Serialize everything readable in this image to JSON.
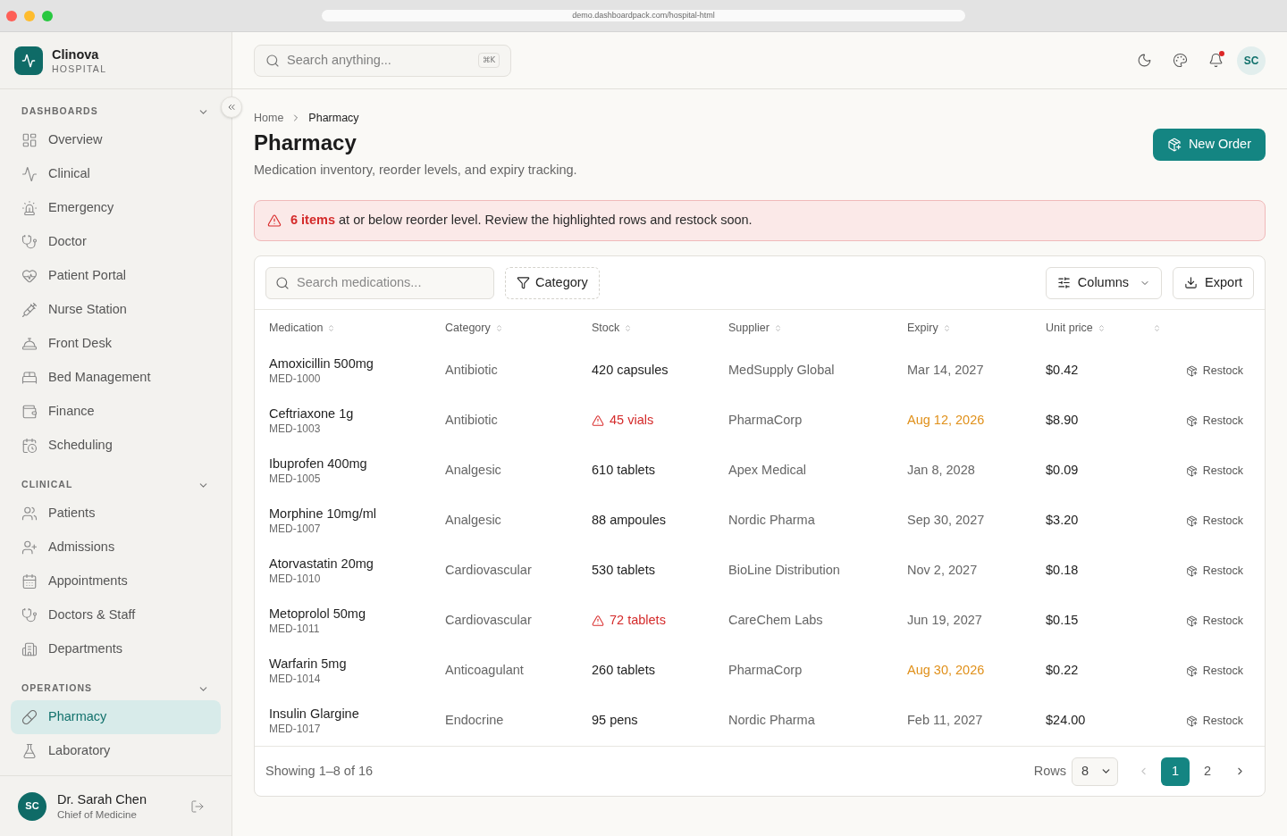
{
  "browser": {
    "url": "demo.dashboardpack.com/hospital-html"
  },
  "sidebar": {
    "brand": {
      "name": "Clinova",
      "subtitle": "HOSPITAL"
    },
    "sections": [
      {
        "title": "DASHBOARDS",
        "expanded": true,
        "items": [
          {
            "label": "Overview",
            "selected": false
          },
          {
            "label": "Clinical",
            "selected": false
          },
          {
            "label": "Emergency",
            "selected": false
          },
          {
            "label": "Doctor",
            "selected": false
          },
          {
            "label": "Patient Portal",
            "selected": false
          },
          {
            "label": "Nurse Station",
            "selected": false
          },
          {
            "label": "Front Desk",
            "selected": false
          },
          {
            "label": "Bed Management",
            "selected": false
          },
          {
            "label": "Finance",
            "selected": false
          },
          {
            "label": "Scheduling",
            "selected": false
          }
        ]
      },
      {
        "title": "CLINICAL",
        "expanded": true,
        "items": [
          {
            "label": "Patients",
            "selected": false
          },
          {
            "label": "Admissions",
            "selected": false
          },
          {
            "label": "Appointments",
            "selected": false
          },
          {
            "label": "Doctors & Staff",
            "selected": false
          },
          {
            "label": "Departments",
            "selected": false
          }
        ]
      },
      {
        "title": "OPERATIONS",
        "expanded": true,
        "items": [
          {
            "label": "Pharmacy",
            "selected": true
          },
          {
            "label": "Laboratory",
            "selected": false
          }
        ]
      }
    ],
    "user": {
      "initials": "SC",
      "name": "Dr. Sarah Chen",
      "role": "Chief of Medicine"
    }
  },
  "header": {
    "search": {
      "placeholder": "Search anything...",
      "shortcut": "⌘K"
    },
    "notifications_unread": true,
    "avatar_initials": "SC"
  },
  "page": {
    "breadcrumb": [
      "Home",
      "Pharmacy"
    ],
    "title": "Pharmacy",
    "subtitle": "Medication inventory, reorder levels, and expiry tracking.",
    "primary_action": "New Order"
  },
  "alert": {
    "text": "**6 items** at or below reorder level. Review the highlighted rows and restock soon."
  },
  "table": {
    "search_placeholder": "Search medications...",
    "filter_label": "Category",
    "columns_button": "Columns",
    "export_button": "Export",
    "columns": [
      "Medication",
      "Category",
      "Stock",
      "Supplier",
      "Expiry",
      "Unit price"
    ],
    "rows": [
      {
        "name": "Amoxicillin 500mg",
        "code": "MED-1000",
        "category": "Antibiotic",
        "stock": "420 capsules",
        "stock_low": false,
        "supplier": "MedSupply Global",
        "expiry": "Mar 14, 2027",
        "expiry_soon": false,
        "unit_price": "$0.42",
        "action": "Restock"
      },
      {
        "name": "Ceftriaxone 1g",
        "code": "MED-1003",
        "category": "Antibiotic",
        "stock": "45 vials",
        "stock_low": true,
        "supplier": "PharmaCorp",
        "expiry": "Aug 12, 2026",
        "expiry_soon": true,
        "unit_price": "$8.90",
        "action": "Restock"
      },
      {
        "name": "Ibuprofen 400mg",
        "code": "MED-1005",
        "category": "Analgesic",
        "stock": "610 tablets",
        "stock_low": false,
        "supplier": "Apex Medical",
        "expiry": "Jan 8, 2028",
        "expiry_soon": false,
        "unit_price": "$0.09",
        "action": "Restock"
      },
      {
        "name": "Morphine 10mg/ml",
        "code": "MED-1007",
        "category": "Analgesic",
        "stock": "88 ampoules",
        "stock_low": false,
        "supplier": "Nordic Pharma",
        "expiry": "Sep 30, 2027",
        "expiry_soon": false,
        "unit_price": "$3.20",
        "action": "Restock"
      },
      {
        "name": "Atorvastatin 20mg",
        "code": "MED-1010",
        "category": "Cardiovascular",
        "stock": "530 tablets",
        "stock_low": false,
        "supplier": "BioLine Distribution",
        "expiry": "Nov 2, 2027",
        "expiry_soon": false,
        "unit_price": "$0.18",
        "action": "Restock"
      },
      {
        "name": "Metoprolol 50mg",
        "code": "MED-1011",
        "category": "Cardiovascular",
        "stock": "72 tablets",
        "stock_low": true,
        "supplier": "CareChem Labs",
        "expiry": "Jun 19, 2027",
        "expiry_soon": false,
        "unit_price": "$0.15",
        "action": "Restock"
      },
      {
        "name": "Warfarin 5mg",
        "code": "MED-1014",
        "category": "Anticoagulant",
        "stock": "260 tablets",
        "stock_low": false,
        "supplier": "PharmaCorp",
        "expiry": "Aug 30, 2026",
        "expiry_soon": true,
        "unit_price": "$0.22",
        "action": "Restock"
      },
      {
        "name": "Insulin Glargine",
        "code": "MED-1017",
        "category": "Endocrine",
        "stock": "95 pens",
        "stock_low": false,
        "supplier": "Nordic Pharma",
        "expiry": "Feb 11, 2027",
        "expiry_soon": false,
        "unit_price": "$24.00",
        "action": "Restock"
      }
    ],
    "footer": {
      "summary": "Showing 1–8 of 16",
      "rows_label": "Rows",
      "rows_per_page": "8",
      "prev_disabled": true,
      "next_disabled": false,
      "pages": [
        {
          "label": "1",
          "selected": true
        },
        {
          "label": "2",
          "selected": false
        }
      ]
    }
  }
}
